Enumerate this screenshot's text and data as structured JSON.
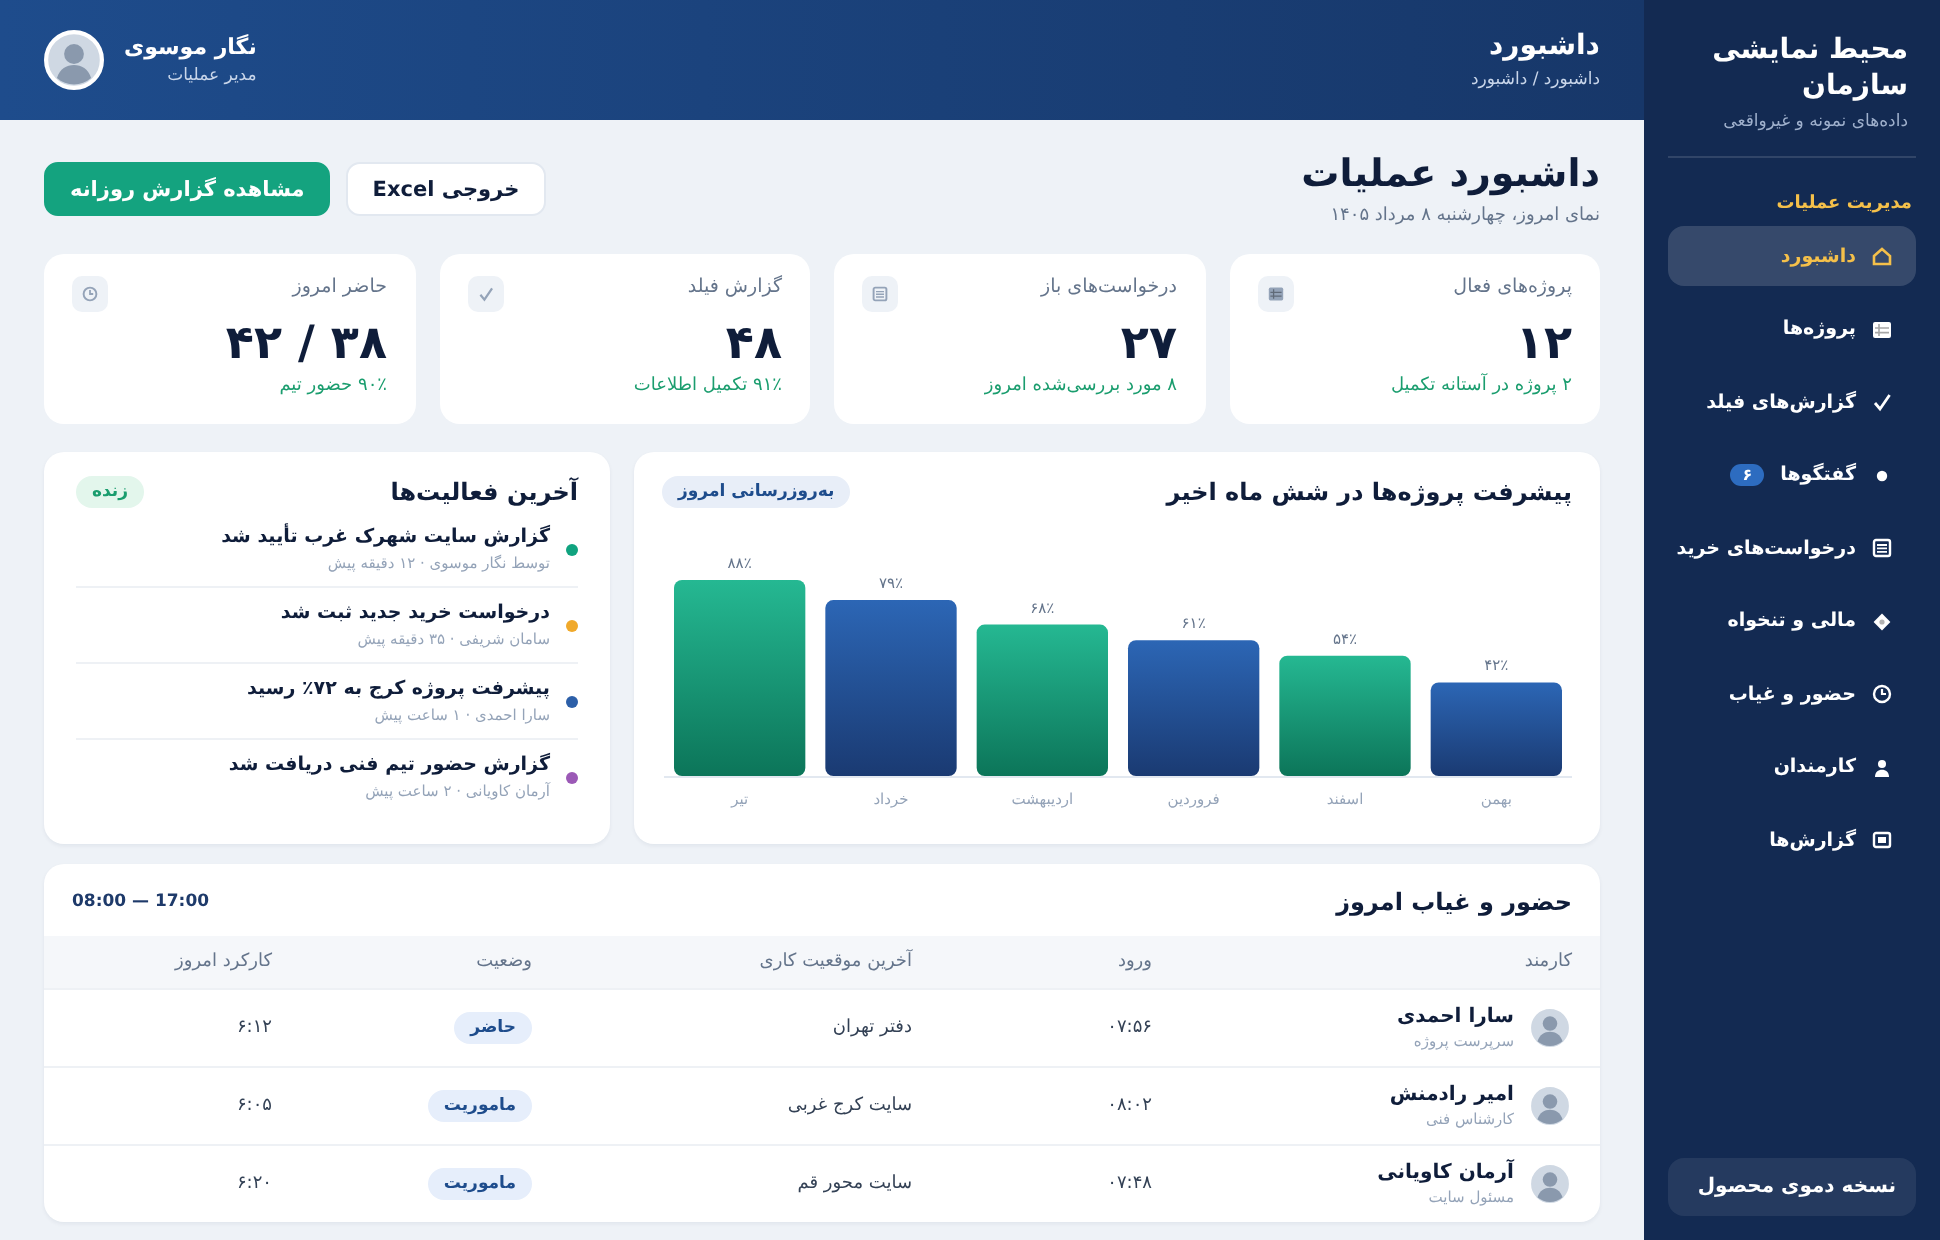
{
  "sidebar": {
    "title": "محیط نمایشی سازمان",
    "subtitle": "داده‌های نمونه و غیرواقعی",
    "section": "مدیریت عملیات",
    "items": [
      {
        "label": "داشبورد",
        "selected": true
      },
      {
        "label": "پروژه‌ها",
        "selected": false
      },
      {
        "label": "گزارش‌های فیلد",
        "selected": false
      },
      {
        "label": "گفتگوها",
        "badge": "۶",
        "selected": false
      },
      {
        "label": "درخواست‌های خرید",
        "selected": false
      },
      {
        "label": "مالی و تنخواه",
        "selected": false
      },
      {
        "label": "حضور و غیاب",
        "selected": false
      },
      {
        "label": "کارمندان",
        "selected": false
      },
      {
        "label": "گزارش‌ها",
        "selected": false
      }
    ],
    "footer": "نسخه دموی محصول"
  },
  "header": {
    "title": "داشبورد",
    "breadcrumb": "داشبورد / داشبورد",
    "user": {
      "name": "نگار موسوی",
      "role": "مدیر عملیات"
    }
  },
  "page": {
    "title": "داشبورد عملیات",
    "subtitle": "نمای امروز، چهارشنبه ۸ مرداد ۱۴۰۵",
    "buttons": [
      {
        "label": "خروجی Excel",
        "kind": "secondary"
      },
      {
        "label": "مشاهده گزارش روزانه",
        "kind": "primary"
      }
    ]
  },
  "stats": [
    {
      "label": "پروژه‌های فعال",
      "value": "۱۲",
      "note": "۲ پروژه در آستانه تکمیل"
    },
    {
      "label": "درخواست‌های باز",
      "value": "۲۷",
      "note": "۸ مورد بررسی‌شده امروز"
    },
    {
      "label": "گزارش فیلد",
      "value": "۴۸",
      "note": "۹۱٪ تکمیل اطلاعات"
    },
    {
      "label": "حاضر امروز",
      "value": "۳۸ / ۴۲",
      "note": "۹۰٪ حضور تیم"
    }
  ],
  "progress": {
    "badge": "به‌روزرسانی امروز",
    "chart_data": {
      "type": "bar",
      "title": "پیشرفت پروژه‌ها در شش ماه اخیر",
      "categories": [
        "تیر",
        "خرداد",
        "اردیبهشت",
        "فروردین",
        "اسفند",
        "بهمن"
      ],
      "values": [
        88,
        79,
        68,
        61,
        54,
        42
      ],
      "value_labels": [
        "۸۸٪",
        "۷۹٪",
        "۶۸٪",
        "۶۱٪",
        "۵۴٪",
        "۴۲٪"
      ]
    }
  },
  "activity": {
    "title": "آخرین فعالیت‌ها",
    "badge": "زنده",
    "items": [
      {
        "title": "گزارش سایت شهرک غرب تأیید شد",
        "meta": "توسط نگار موسوی · ۱۲ دقیقه پیش",
        "color": "#10a37f"
      },
      {
        "title": "درخواست خرید جدید ثبت شد",
        "meta": "سامان شریفی · ۳۵ دقیقه پیش",
        "color": "#f0a92b"
      },
      {
        "title": "پیشرفت پروژه کرج به ۷۲٪ رسید",
        "meta": "سارا احمدی · ۱ ساعت پیش",
        "color": "#2c5fa8"
      },
      {
        "title": "گزارش حضور تیم فنی دریافت شد",
        "meta": "آرمان کاویانی · ۲ ساعت پیش",
        "color": "#9b59b6"
      }
    ]
  },
  "attendance": {
    "title": "حضور و غیاب امروز",
    "hours": "08:00 — 17:00",
    "columns": [
      "کارمند",
      "ورود",
      "آخرین موقعیت کاری",
      "وضعیت",
      "کارکرد امروز"
    ],
    "rows": [
      {
        "name": "سارا احمدی",
        "role": "سرپرست پروژه",
        "entry": "۰۷:۵۶",
        "location": "دفتر تهران",
        "status": "حاضر",
        "hours": "۶:۱۲"
      },
      {
        "name": "امیر رادمنش",
        "role": "کارشناس فنی",
        "entry": "۰۸:۰۲",
        "location": "سایت کرج غربی",
        "status": "ماموریت",
        "hours": "۶:۰۵"
      },
      {
        "name": "آرمان کاویانی",
        "role": "مسئول سایت",
        "entry": "۰۷:۴۸",
        "location": "سایت محور قم",
        "status": "ماموریت",
        "hours": "۶:۲۰"
      }
    ]
  }
}
